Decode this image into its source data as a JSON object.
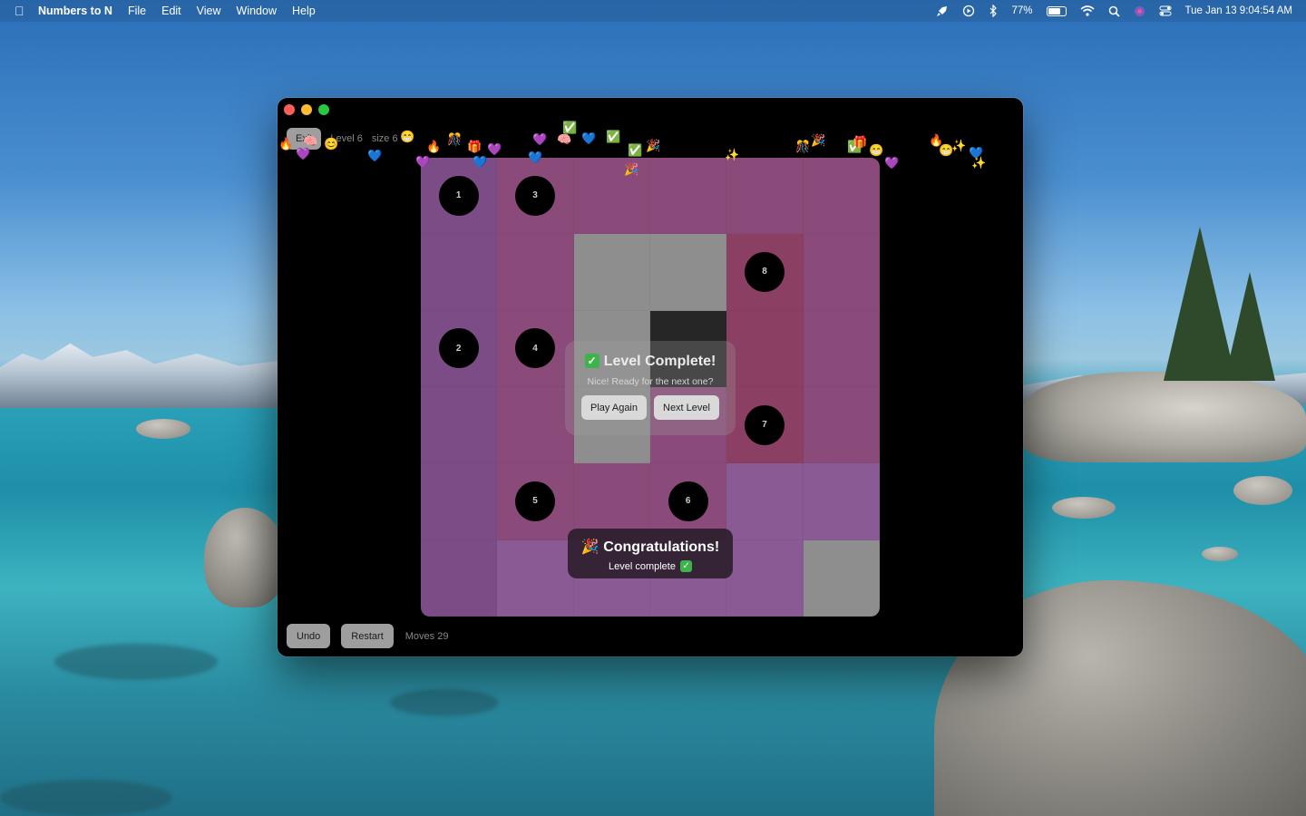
{
  "menubar": {
    "app_name": "Numbers to N",
    "menus": [
      "File",
      "Edit",
      "View",
      "Window",
      "Help"
    ],
    "battery": "77%",
    "battery_level": 0.77,
    "clock": "Tue Jan 13  9:04:54 AM"
  },
  "game": {
    "exit_label": "Exit",
    "level_label": "Level 6",
    "size_label": "size 6",
    "board_size": 6,
    "colors": {
      "path_pink": "#8a4b7a",
      "path_rose": "#8b3f62",
      "path_violet": "#7b4c86",
      "path_lilac": "#8a5a94",
      "empty_gray": "#8e8e8e",
      "wall_dark": "#262626"
    },
    "cells": [
      [
        "v",
        "p",
        "p",
        "p",
        "p",
        "p"
      ],
      [
        "v",
        "p",
        "g",
        "g",
        "r",
        "p"
      ],
      [
        "v",
        "p",
        "g",
        "d",
        "r",
        "p"
      ],
      [
        "v",
        "p",
        "g",
        "p",
        "r",
        "p"
      ],
      [
        "v",
        "p",
        "p",
        "p",
        "l",
        "l"
      ],
      [
        "v",
        "l",
        "l",
        "l",
        "l",
        "g"
      ]
    ],
    "nodes": [
      {
        "row": 0,
        "col": 0,
        "label": "1"
      },
      {
        "row": 0,
        "col": 1,
        "label": "3"
      },
      {
        "row": 1,
        "col": 4,
        "label": "8"
      },
      {
        "row": 2,
        "col": 0,
        "label": "2"
      },
      {
        "row": 2,
        "col": 1,
        "label": "4"
      },
      {
        "row": 3,
        "col": 4,
        "label": "7"
      },
      {
        "row": 4,
        "col": 1,
        "label": "5"
      },
      {
        "row": 4,
        "col": 3,
        "label": "6"
      }
    ],
    "dialog": {
      "title": "Level Complete!",
      "subtitle": "Nice! Ready for the next one?",
      "play_again": "Play Again",
      "next_level": "Next Level"
    },
    "toast": {
      "title": "Congratulations!",
      "subtitle": "Level complete"
    },
    "undo_label": "Undo",
    "restart_label": "Restart",
    "moves_label": "Moves 29"
  },
  "confetti": [
    "🔥",
    "🧠",
    "😊",
    "😁",
    "🎊",
    "🎁",
    "💜",
    "💙",
    "✅",
    "🎉",
    "✨"
  ]
}
